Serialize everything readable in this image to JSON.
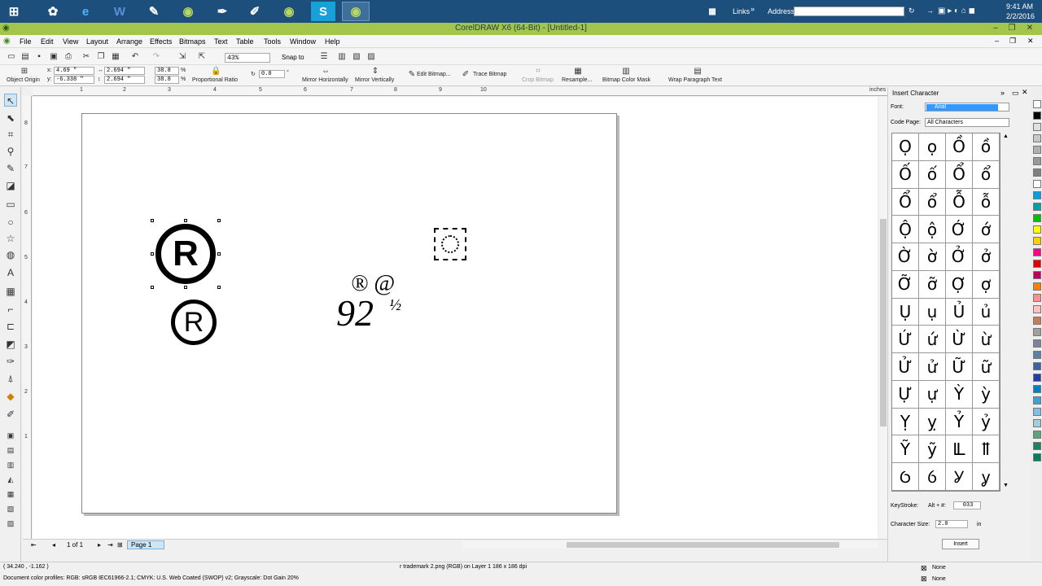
{
  "taskbar": {
    "links": "Links",
    "address_label": "Address",
    "time": "9:41 AM",
    "date": "2/2/2016"
  },
  "window": {
    "title": "CorelDRAW X6 (64-Bit) - [Untitled-1]"
  },
  "menu": {
    "items": [
      "File",
      "Edit",
      "View",
      "Layout",
      "Arrange",
      "Effects",
      "Bitmaps",
      "Text",
      "Table",
      "Tools",
      "Window",
      "Help"
    ]
  },
  "standard_toolbar": {
    "zoom": "43%",
    "snap_to": "Snap to"
  },
  "property_bar": {
    "x": "4.69 \"",
    "y": "-6.338 \"",
    "w": "2.694 \"",
    "h": "2.694 \"",
    "scale_w": "38.8",
    "scale_h": "38.8",
    "percent": "%",
    "angle": "0.0",
    "object_origin": "Object Origin",
    "proportional_ratio": "Proportional Ratio",
    "mirror_h": "Mirror Horizontally",
    "mirror_v": "Mirror Vertically",
    "edit_bitmap": "Edit Bitmap...",
    "trace_bitmap": "Trace Bitmap",
    "crop_bitmap": "Crop Bitmap",
    "resample": "Resample...",
    "bitmap_color_mask": "Bitmap Color Mask",
    "wrap_paragraph_text": "Wrap Paragraph Text"
  },
  "rulers": {
    "h_ticks": [
      "1",
      "2",
      "3",
      "4",
      "5",
      "6",
      "7",
      "8",
      "9",
      "10"
    ],
    "v_ticks": [
      "1",
      "2",
      "3",
      "4",
      "5",
      "6",
      "7",
      "8"
    ],
    "unit": "inches"
  },
  "canvas": {
    "symbol_reg": "®",
    "text_line1": "® @",
    "text_number": "92",
    "text_fraction": "½"
  },
  "doc_nav": {
    "page_count": "1 of 1",
    "page_tab": "Page 1"
  },
  "docker": {
    "title": "Insert Character",
    "font_label": "Font:",
    "font_value": "Arial",
    "code_page_label": "Code Page:",
    "code_page_value": "All Characters",
    "chars": [
      "Ọ",
      "ọ",
      "Ồ",
      "ồ",
      "Ố",
      "ố",
      "Ổ",
      "ổ",
      "Ổ",
      "ổ",
      "Ỗ",
      "ỗ",
      "Ộ",
      "ộ",
      "Ớ",
      "ớ",
      "Ờ",
      "ờ",
      "Ở",
      "ở",
      "Ỡ",
      "ỡ",
      "Ợ",
      "ợ",
      "Ụ",
      "ụ",
      "Ủ",
      "ủ",
      "Ứ",
      "ứ",
      "Ừ",
      "ừ",
      "Ử",
      "ử",
      "Ữ",
      "ữ",
      "Ự",
      "ự",
      "Ỳ",
      "ỳ",
      "Ỵ",
      "ỵ",
      "Ỷ",
      "ỷ",
      "Ỹ",
      "ỹ",
      "Ỻ",
      "ỻ",
      "Ỽ",
      "ỽ",
      "Ỿ",
      "ỿ"
    ],
    "keystroke_label": "KeyStroke:",
    "alt_label": "Alt + #:",
    "alt_value": "033",
    "char_size_label": "Character Size:",
    "char_size_value": "2.0",
    "char_size_unit": "in",
    "insert_button": "Insert"
  },
  "status": {
    "coords": "( 34.240 , -1.162 )",
    "object_info": "r trademark 2.png (RGB) on Layer 1 186 x 186 dpi",
    "color_profiles": "Document color profiles: RGB: sRGB IEC61966-2.1; CMYK: U.S. Web Coated (SWOP) v2; Grayscale: Dot Gain 20%",
    "fill": "None",
    "outline": "None"
  },
  "palette_colors": [
    "#ffffff",
    "#000000",
    "#e0e0e0",
    "#c8c8c8",
    "#b0b0b0",
    "#989898",
    "#808080",
    "#ffffff",
    "#00a0e0",
    "#00a0a0",
    "#00c000",
    "#ffff00",
    "#ffd000",
    "#ff0080",
    "#e00000",
    "#c00060",
    "#ff8000",
    "#ff9090",
    "#ffc0c0",
    "#c08060",
    "#a0a0a0",
    "#8080a0",
    "#6080a0",
    "#4060a0",
    "#2040a0",
    "#0080c0",
    "#40a0d0",
    "#80c0e0",
    "#a0d0e0",
    "#60a080",
    "#208060",
    "#008060"
  ]
}
